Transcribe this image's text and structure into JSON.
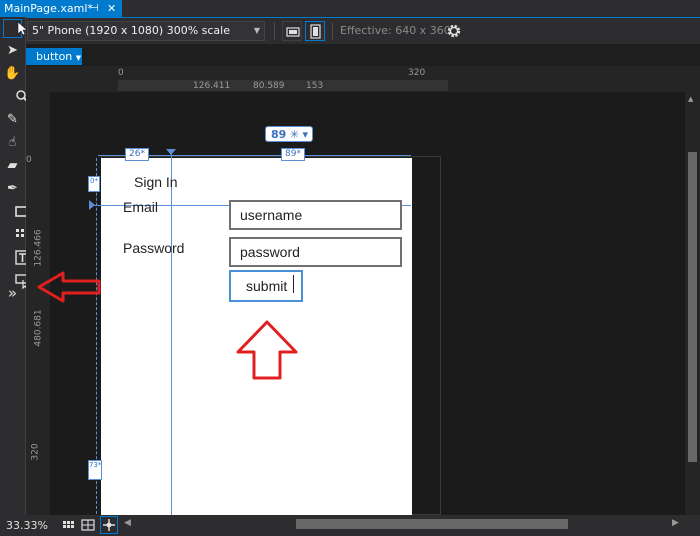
{
  "doc_tab": {
    "title": "MainPage.xaml*",
    "pin_icon": "pin-icon",
    "close_glyph": "✕"
  },
  "toolbar": {
    "device": "5\" Phone (1920 x 1080) 300% scale",
    "effective": "Effective: 640 x 360"
  },
  "breadcrumb": {
    "element": "button"
  },
  "rulers": {
    "top_marks": [
      "0",
      "320"
    ],
    "top_offsets": [
      "126.411",
      "80.589",
      "153"
    ],
    "left_marks": [
      "0",
      "126.466",
      "480.681",
      "320"
    ]
  },
  "design": {
    "width_badge": "89",
    "left_margin": "26*",
    "col_width": "89*",
    "top_margin": "0*",
    "bottom_margin": "73*",
    "title": "Sign In",
    "email_label": "Email",
    "password_label": "Password",
    "username_value": "username",
    "password_value": "password",
    "submit_label": "submit"
  },
  "status": {
    "zoom": "33.33%"
  },
  "colors": {
    "accent": "#007acc",
    "annotation_arrow": "#e02020"
  }
}
